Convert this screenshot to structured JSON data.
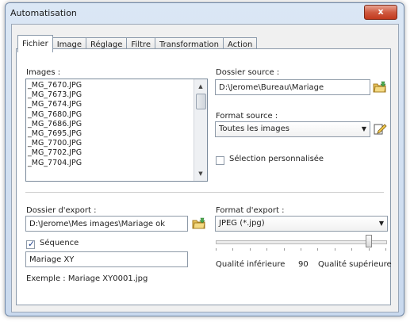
{
  "window": {
    "title": "Automatisation",
    "close_glyph": "x"
  },
  "tabs": [
    {
      "label": "Fichier",
      "active": true
    },
    {
      "label": "Image",
      "active": false
    },
    {
      "label": "Réglage",
      "active": false
    },
    {
      "label": "Filtre",
      "active": false
    },
    {
      "label": "Transformation",
      "active": false
    },
    {
      "label": "Action",
      "active": false
    }
  ],
  "images": {
    "label": "Images :",
    "items": [
      "_MG_7670.JPG",
      "_MG_7673.JPG",
      "_MG_7674.JPG",
      "_MG_7680.JPG",
      "_MG_7686.JPG",
      "_MG_7695.JPG",
      "_MG_7700.JPG",
      "_MG_7702.JPG",
      "_MG_7704.JPG"
    ]
  },
  "source": {
    "folder_label": "Dossier source :",
    "folder_value": "D:\\Jerome\\Bureau\\Mariage",
    "format_label": "Format source :",
    "format_value": "Toutes les images",
    "custom_selection_label": "Sélection personnalisée",
    "custom_selection_checked": false
  },
  "export": {
    "folder_label": "Dossier d'export :",
    "folder_value": "D:\\Jerome\\Mes images\\Mariage ok",
    "sequence_label": "Séquence",
    "sequence_checked": true,
    "sequence_value": "Mariage XY",
    "example_text": "Exemple : Mariage XY0001.jpg",
    "format_label": "Format d'export :",
    "format_value": "JPEG (*.jpg)",
    "quality_low_label": "Qualité inférieure",
    "quality_value": "90",
    "quality_high_label": "Qualité supérieure",
    "quality_fraction": 0.9
  },
  "icons": {
    "browse": "folder-browse-icon",
    "edit": "edit-icon"
  }
}
